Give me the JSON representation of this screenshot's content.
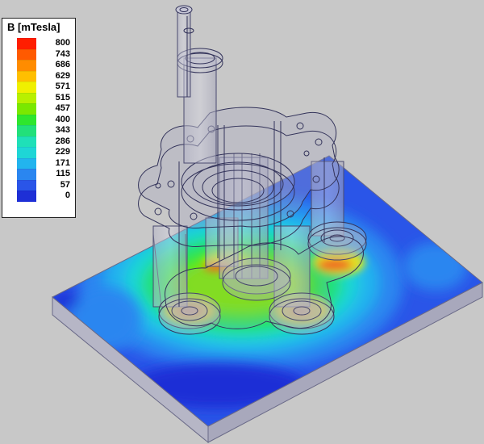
{
  "legend": {
    "title": "B [mTesla]",
    "entries": [
      {
        "label": "800",
        "color": "#ff1e00"
      },
      {
        "label": "743",
        "color": "#ff5a00"
      },
      {
        "label": "686",
        "color": "#ff8c00"
      },
      {
        "label": "629",
        "color": "#ffbf00"
      },
      {
        "label": "571",
        "color": "#f0f000"
      },
      {
        "label": "515",
        "color": "#b8f000"
      },
      {
        "label": "457",
        "color": "#7ae800"
      },
      {
        "label": "400",
        "color": "#2ee62e"
      },
      {
        "label": "343",
        "color": "#22e07a"
      },
      {
        "label": "286",
        "color": "#1fe0b8"
      },
      {
        "label": "229",
        "color": "#1ed6d6"
      },
      {
        "label": "171",
        "color": "#22b4ee"
      },
      {
        "label": "115",
        "color": "#2a86f0"
      },
      {
        "label": "57",
        "color": "#2a55e8"
      },
      {
        "label": "0",
        "color": "#1e2fd6"
      }
    ]
  },
  "colors": {
    "background": "#c8c8c8",
    "outline": "#3a3a5a",
    "ghost_fill": "#9a9ab4"
  }
}
